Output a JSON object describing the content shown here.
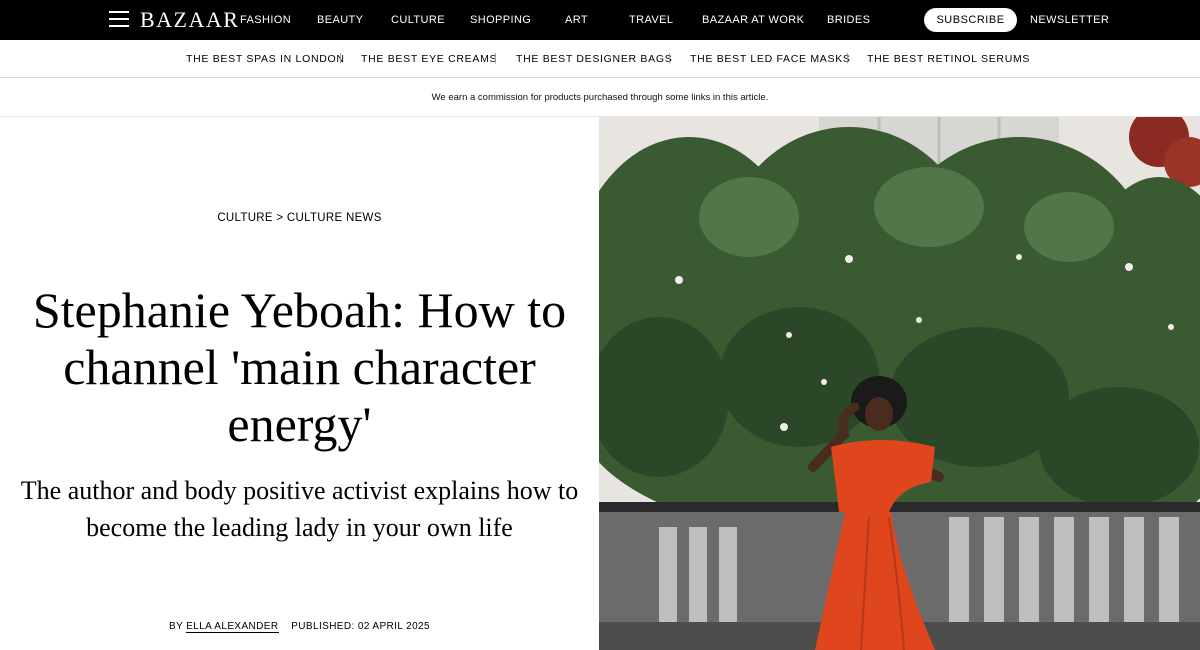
{
  "header": {
    "logo": "BAZAAR",
    "nav": [
      "FASHION",
      "BEAUTY",
      "CULTURE",
      "SHOPPING",
      "ART",
      "TRAVEL",
      "BAZAAR AT WORK",
      "BRIDES"
    ],
    "subscribe_label": "SUBSCRIBE",
    "newsletter_label": "NEWSLETTER"
  },
  "trending": [
    "THE BEST SPAS IN LONDON",
    "THE BEST EYE CREAMS",
    "THE BEST DESIGNER BAGS",
    "THE BEST LED FACE MASKS",
    "THE BEST RETINOL SERUMS"
  ],
  "separator": "|",
  "commission_note": "We earn a commission for products purchased through some links in this article.",
  "article": {
    "breadcrumb": {
      "section": "CULTURE",
      "separator": ">",
      "subsection": "CULTURE NEWS"
    },
    "title": "Stephanie Yeboah: How to channel 'main character energy'",
    "dek": "The author and body positive activist explains how to become the leading lady in your own life",
    "byline_prefix": "BY",
    "author": "ELLA ALEXANDER",
    "published": "PUBLISHED: 02 APRIL 2025"
  },
  "colors": {
    "nav_bg": "#000000",
    "dress": "#e0461e",
    "foliage": "#3a5a32",
    "wall": "#e8e4df"
  }
}
